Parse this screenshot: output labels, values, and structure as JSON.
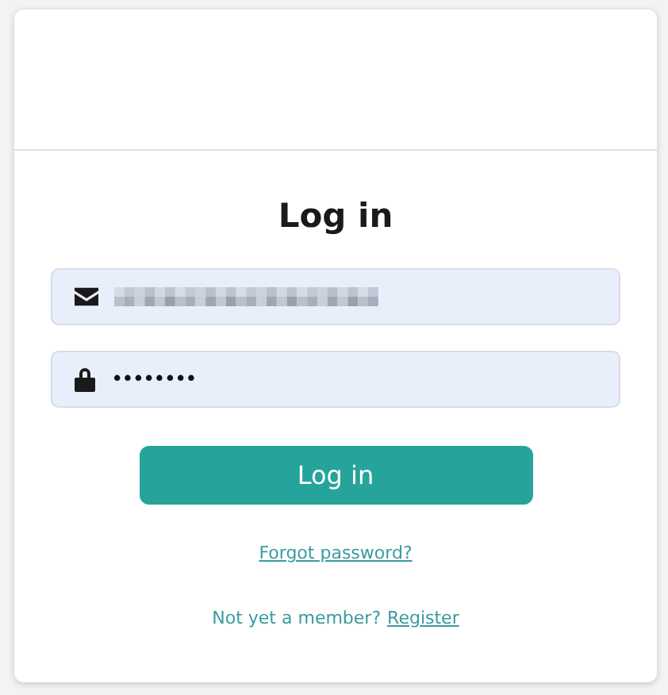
{
  "title": "Log in",
  "fields": [
    {
      "kind": "email",
      "redacted": true
    },
    {
      "kind": "password",
      "redacted": false,
      "value": "••••••••"
    }
  ],
  "submit_button": "Log in",
  "forgot_link": "Forgot password?",
  "register_prompt": "Not yet a member?",
  "register_link": "Register"
}
